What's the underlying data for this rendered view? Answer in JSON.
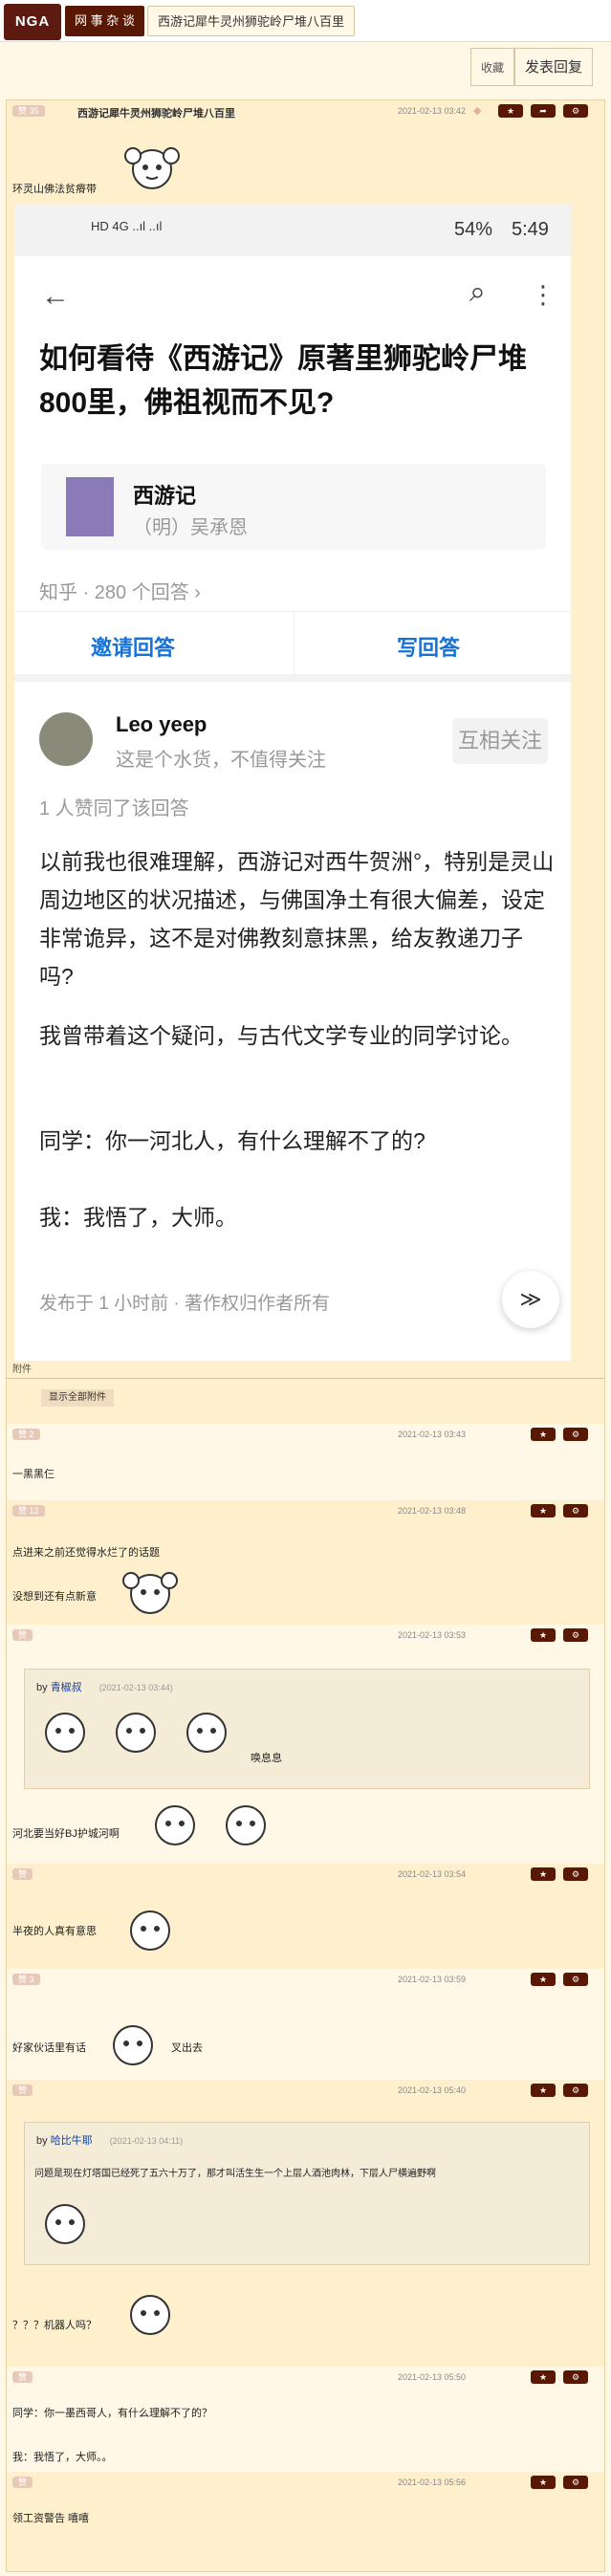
{
  "nav": {
    "logo": "NGA",
    "crumb1": "网 事 杂 谈",
    "crumb2": "西游记犀牛灵州狮驼岭尸堆八百里"
  },
  "toolbar": {
    "fav": "收藏",
    "reply": "发表回复"
  },
  "colors": {
    "brand": "#591804",
    "bg": "#fff8e7",
    "alt_bg": "#fff0cd",
    "link": "#1772d6"
  },
  "op": {
    "title": "西游记犀牛灵州狮驼岭尸堆八百里",
    "time": "2021-02-13 03:42",
    "caption": "环灵山佛法贫瘠带"
  },
  "shot": {
    "status_left": "HD 4G ..ıl ..ıl",
    "status_right": "54%",
    "status_clock": "5:49",
    "zh_title": "如何看待《西游记》原著里狮驼岭尸堆800里，佛祖视而不见?",
    "book_name": "西游记",
    "book_author": "（明）吴承恩",
    "meta": "知乎 · 280 个回答 ›",
    "invite": "邀请回答",
    "write": "写回答",
    "author": "Leo yeep",
    "author_desc": "这是个水货，不值得关注",
    "follow": "互相关注",
    "agree": "1 人赞同了该回答",
    "p1": "以前我也很难理解，西游记对西牛贺洲°，特别是灵山周边地区的状况描述，与佛国净土有很大偏差，设定非常诡异，这不是对佛教刻意抹黑，给友教递刀子吗?",
    "p2": "我曾带着这个疑问，与古代文学专业的同学讨论。",
    "p3": "同学：你一河北人，有什么理解不了的?",
    "p4": "我：我悟了，大师。",
    "pub": "发布于 1 小时前 · 著作权归作者所有",
    "fab": "≫"
  },
  "attach": {
    "title": "附件",
    "show_all": "显示全部附件"
  },
  "replies": [
    {
      "time": "2021-02-13 03:43",
      "text": "一黑黑仨"
    },
    {
      "time": "2021-02-13 03:48",
      "text": "点进来之前还觉得水烂了的话题",
      "text2": "没想到还有点新意"
    },
    {
      "time": "2021-02-13 03:53",
      "quote_user": "青椒叔",
      "quote_time": "(2021-02-13 03:44)",
      "quote_text": "唤息息",
      "text": "河北要当好BJ护城河啊"
    },
    {
      "time": "2021-02-13 03:54",
      "text": "半夜的人真有意思"
    },
    {
      "time": "2021-02-13 03:59",
      "text": "好家伙话里有话",
      "text2": "叉出去"
    },
    {
      "time": "2021-02-13 05:40",
      "quote_user": "哈比牛耶",
      "quote_time": "(2021-02-13 04:11)",
      "quote_text": "问题是现在灯塔国已经死了五六十万了，那才叫活生生一个上层人酒池肉林，下层人尸横遍野啊",
      "text": "？？？机器人吗？"
    },
    {
      "time": "2021-02-13 05:50",
      "text": "同学：你一墨西哥人，有什么理解不了的？",
      "text2": "我：我悟了，大师。。"
    },
    {
      "time": "2021-02-13 05:56",
      "text": "领工资警告 嘻嘻"
    }
  ],
  "by": "by",
  "icons": {
    "star": "star-icon",
    "share": "share-icon",
    "gear": "gear-icon"
  }
}
